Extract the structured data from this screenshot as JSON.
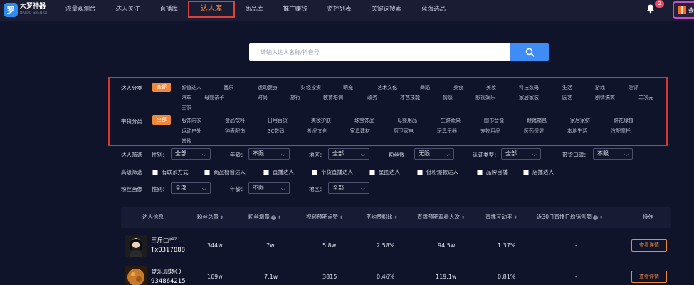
{
  "brand": {
    "cn": "大罗神器",
    "en": "DALUO SHEN QI",
    "mark": "罗"
  },
  "nav": [
    "流量观测台",
    "达人关注",
    "直播库",
    "达人库",
    "商品库",
    "推广赚钱",
    "监控列表",
    "关键词搜索",
    "蓝海选品"
  ],
  "notifications": {
    "count": "2",
    "icon": "bell-icon"
  },
  "gift": {
    "icon": "gift-icon",
    "label": "会"
  },
  "search": {
    "placeholder": "请输入达人名称/抖音号",
    "icon": "search-icon"
  },
  "categories": {
    "label": "达人分类",
    "all": "全部",
    "items": [
      "颜值达人",
      "音乐",
      "运动健身",
      "财经投资",
      "萌宠",
      "艺术文化",
      "舞蹈",
      "美食",
      "美妆",
      "科技数码",
      "生活",
      "游戏",
      "测评",
      "汽车",
      "母婴亲子",
      "时尚",
      "旅行",
      "教育培训",
      "政务",
      "才艺技能",
      "情感",
      "影视娱乐",
      "家居家装",
      "园艺",
      "剧情搞笑",
      "二次元",
      "三农"
    ]
  },
  "goods": {
    "label": "带货分类",
    "all": "全部",
    "items": [
      "服饰内衣",
      "食品饮料",
      "日用百货",
      "美妆护肤",
      "珠宝饰品",
      "母婴用品",
      "生鲜蔬果",
      "图书音像",
      "鞋靴箱包",
      "家居家纺",
      "鲜花绿植",
      "运动户外",
      "钟表配饰",
      "3C数码",
      "礼品文创",
      "家具建材",
      "厨卫家电",
      "玩具乐器",
      "宠物用品",
      "医药保健",
      "本地生活",
      "汽配摩托",
      "其他"
    ]
  },
  "filters": {
    "row1_label": "达人筛选",
    "gender": {
      "label": "性别：",
      "value": "全部"
    },
    "age": {
      "label": "年龄：",
      "value": "不限"
    },
    "region": {
      "label": "地区：",
      "value": "全部"
    },
    "fans": {
      "label": "粉丝数：",
      "value": "无限"
    },
    "verify": {
      "label": "认证类型：",
      "value": "全部"
    },
    "reputation": {
      "label": "带货口碑：",
      "value": "不限"
    },
    "row2_label": "高级筛选",
    "checks": [
      "有联系方式",
      "商品橱窗达人",
      "直播达人",
      "带货直播达人",
      "星图达人",
      "低粉爆款达人",
      "品牌自播",
      "店播达人"
    ],
    "row3_label": "粉丝画像",
    "p_gender": {
      "label": "性别：",
      "value": "全部"
    },
    "p_age": {
      "label": "年龄：",
      "value": "不限"
    },
    "p_region": {
      "label": "地区：",
      "value": "全部"
    }
  },
  "table": {
    "headers": [
      "达人信息",
      "粉丝总量",
      "粉丝增量",
      "视频预期点赞",
      "平均赞粉比",
      "直播预期观看人次",
      "直播互动率",
      "近30日直播日均销售额",
      "操作"
    ],
    "rows": [
      {
        "name": "三斤□*⁰⁷ ...",
        "id": "Tx0317888",
        "fans": "344w",
        "growth": "7w",
        "likes": "5.8w",
        "ratio": "2.58%",
        "views": "94.5w",
        "interact": "1.37%",
        "sales": "-",
        "action": "查看详情"
      },
      {
        "name": "登乐现场〇",
        "id": "934864215",
        "fans": "169w",
        "growth": "7.1w",
        "likes": "3815",
        "ratio": "0.46%",
        "views": "119.1w",
        "interact": "0.81%",
        "sales": "-",
        "action": "查看详情"
      }
    ]
  }
}
